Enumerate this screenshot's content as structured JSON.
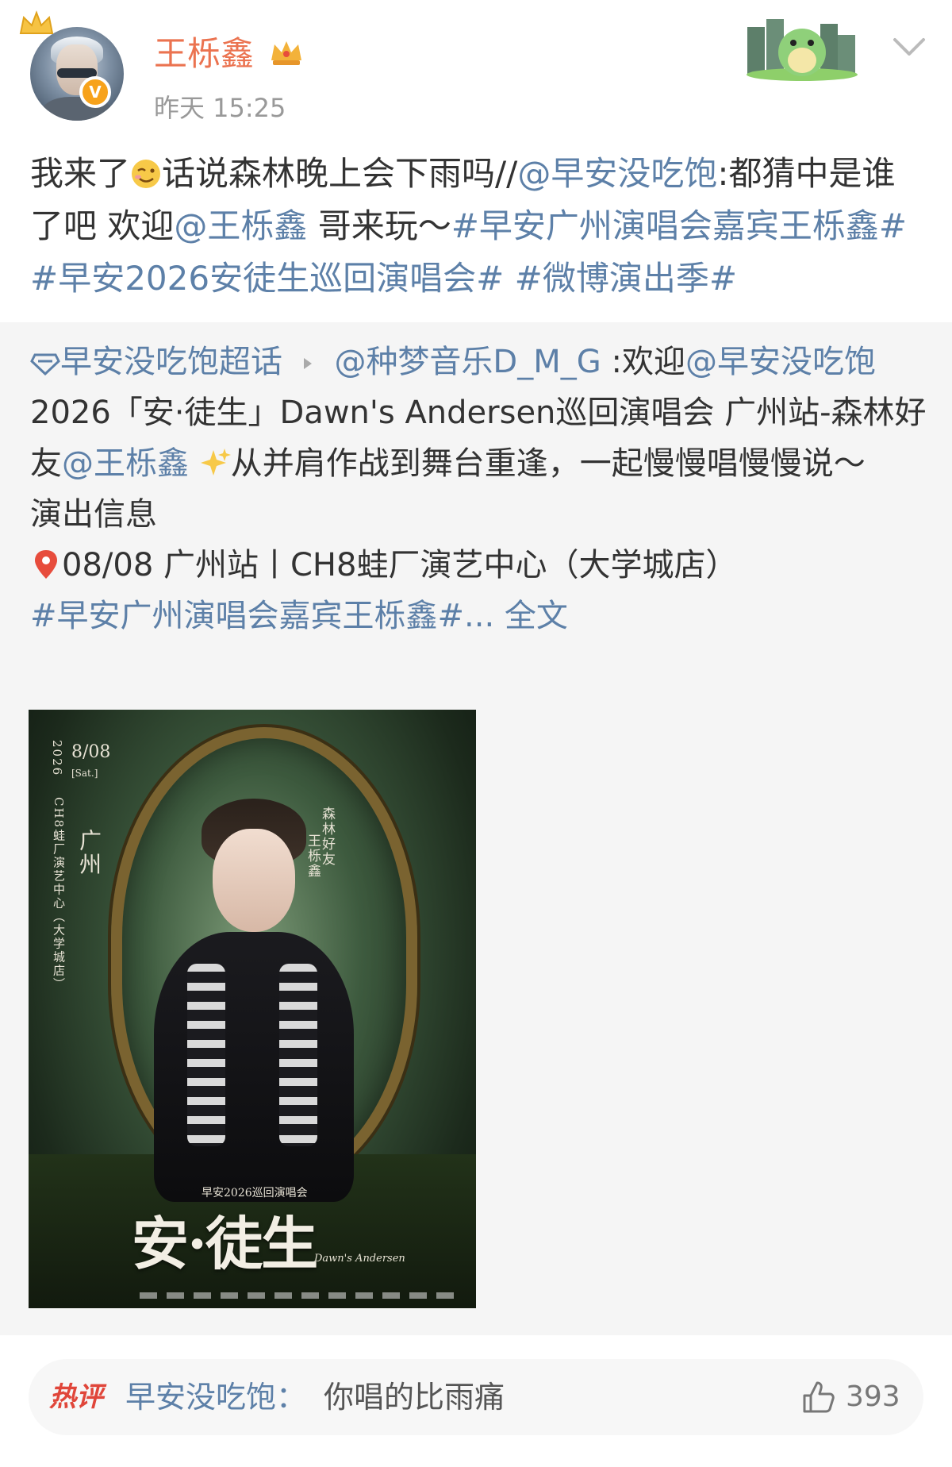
{
  "header": {
    "username": "王栎鑫",
    "time": "昨天 15:25"
  },
  "post": {
    "segments": [
      {
        "text": "我来了",
        "type": "text"
      },
      {
        "text": "话说森林晚上会下雨吗//",
        "type": "text"
      },
      {
        "text": "@早安没吃饱",
        "type": "link"
      },
      {
        "text": ":都猜中是谁了吧 欢迎",
        "type": "text"
      },
      {
        "text": "@王栎鑫",
        "type": "link"
      },
      {
        "text": " 哥来玩～",
        "type": "text"
      },
      {
        "text": "#早安广州演唱会嘉宾王栎鑫#",
        "type": "link"
      },
      {
        "text": " ",
        "type": "text"
      },
      {
        "text": "#早安2026安徒生巡回演唱会#",
        "type": "link"
      },
      {
        "text": " ",
        "type": "text"
      },
      {
        "text": "#微博演出季#",
        "type": "link"
      }
    ]
  },
  "repost": {
    "supertopic": "早安没吃饱超话",
    "author": "@种梦音乐D_M_G",
    "line1_rest": " :欢迎",
    "mention1": "@早安没吃饱",
    "text1": "2026「安·徒生」Dawn's Andersen巡回演唱会 广州站-森林好友",
    "mention2": "@王栎鑫",
    "text2": "从并肩作战到舞台重逢，一起慢慢唱慢慢说～",
    "info_title": "演出信息",
    "info_line": "08/08 广州站丨CH8蛙厂演艺中心（大学城店）",
    "hashtag": "#早安广州演唱会嘉宾王栎鑫#",
    "ellipsis": "... ",
    "full_text": "全文"
  },
  "poster": {
    "year": "2026",
    "date": "8/08",
    "day": "[Sat.]",
    "venue": "CH8蛙厂演艺中心（大学城店）",
    "city": "广州",
    "friend_label": "森林好友",
    "guest_name": "王栎鑫",
    "subtitle": "早安2026巡回演唱会",
    "title": "安·徒生",
    "title_en": "Dawn's Andersen"
  },
  "hot_comment": {
    "badge": "热评",
    "author": "早安没吃饱：",
    "text": "你唱的比雨痛",
    "likes": "393"
  },
  "colors": {
    "link": "#5d80a8",
    "username": "#eb7350",
    "hot": "#e0463a"
  }
}
